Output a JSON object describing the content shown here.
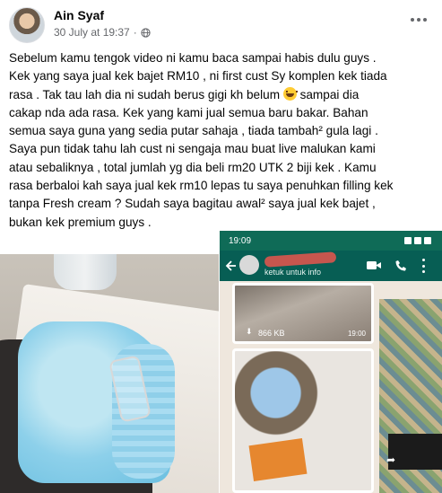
{
  "post": {
    "author": "Ain Syaf",
    "date": "30 July at 19:37",
    "separator": "·",
    "lines": [
      "Sebelum kamu tengok video ni kamu baca sampai habis dulu guys .",
      "Kek yang saya jual kek bajet RM10 , ni first cust Sy komplen kek tiada",
      "rasa . Tak tau lah dia ni sudah berus gigi kh belum ",
      " sampai dia",
      "cakap nda ada rasa. Kek yang kami jual semua baru bakar. Bahan",
      "semua saya guna yang sedia putar sahaja , tiada tambah² gula lagi .",
      "Saya pun tidak tahu lah cust ni sengaja mau buat live malukan kami",
      "atau sebaliknya , total jumlah yg dia beli rm20 UTK 2 biji kek . Kamu",
      "rasa berbaloi kah saya jual kek rm10 lepas tu saya penuhkan filling kek",
      "tanpa Fresh cream ? Sudah saya bagitau awal² saya jual kek bajet ,",
      "bukan kek premium guys ."
    ]
  },
  "screenshot": {
    "status_time": "19:09",
    "chat_subtitle": "ketuk untuk info",
    "file_size": "866 KB",
    "video_time": "19:00"
  },
  "icons": {
    "audience": "globe-icon",
    "options": "more-options-icon",
    "emoji": "grinning-face-icon",
    "back": "back-arrow-icon",
    "video": "video-call-icon",
    "call": "phone-call-icon",
    "menu": "vertical-dots-icon",
    "download": "download-icon",
    "share": "share-icon"
  },
  "colors": {
    "text": "#050505",
    "meta": "#65676b",
    "whatsapp_bar": "#075e54",
    "whatsapp_status": "#0f6b57",
    "cake_blue": "#8dd0ea"
  }
}
